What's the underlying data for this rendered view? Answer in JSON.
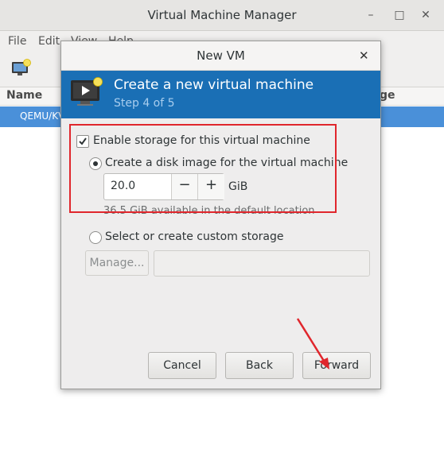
{
  "main_window": {
    "title": "Virtual Machine Manager",
    "menu": [
      "File",
      "Edit",
      "View",
      "Help"
    ],
    "list_header_left": "Name",
    "list_header_right": "ge",
    "selected_row": "QEMU/KV"
  },
  "dialog": {
    "title": "New VM",
    "banner_title": "Create a new virtual machine",
    "banner_step": "Step 4 of 5",
    "enable_storage_label": "Enable storage for this virtual machine",
    "enable_storage_checked": true,
    "create_disk_label": "Create a disk image for the virtual machine",
    "disk_size": "20.0",
    "disk_unit": "GiB",
    "available_text": "36.5 GiB available in the default location",
    "custom_storage_label": "Select or create custom storage",
    "manage_label": "Manage...",
    "buttons": {
      "cancel": "Cancel",
      "back": "Back",
      "forward": "Forward"
    }
  },
  "colors": {
    "banner": "#1a6fb5",
    "selection": "#4a90d9",
    "highlight_box": "#e0262c",
    "annotation_arrow": "#e0262c"
  }
}
